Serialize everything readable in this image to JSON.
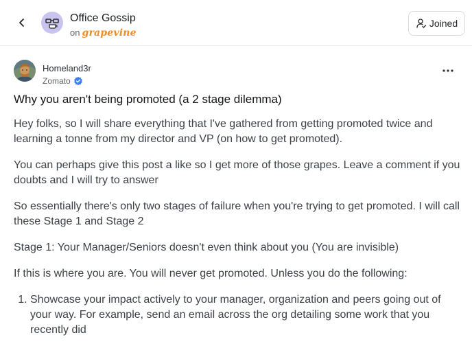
{
  "header": {
    "community_name": "Office Gossip",
    "on_label": "on",
    "brand_name": "grapevine",
    "joined_label": "Joined"
  },
  "post": {
    "author": {
      "name": "Homeland3r",
      "company": "Zomato",
      "verified": true
    },
    "title": "Why you aren't being promoted (a 2 stage dilemma)",
    "paragraphs": [
      "Hey folks, so I will share everything that I've gathered from getting promoted twice and learning a tonne from my director and VP (on how to get promoted).",
      "You can perhaps give this post a like so I get more of those grapes. Leave a comment if you doubts and I will try to answer",
      "So essentially there's only two stages of failure when you're trying to get promoted. I will call these Stage 1 and Stage 2",
      "Stage 1: Your Manager/Seniors doesn't even think about you (You are invisible)",
      "If this is where you are. You will never get promoted. Unless you do the following:"
    ],
    "list_items": [
      "Showcase your impact actively to your manager, organization and peers going out of your way. For example, send an email across the org detailing some work that you recently did"
    ]
  },
  "colors": {
    "brand": "#f08a24",
    "verified": "#3b82f6",
    "community_avatar_bg": "#c9c3f0"
  },
  "icons": {
    "back": "chevron-left-icon",
    "joined": "user-icon",
    "more": "more-horizontal-icon",
    "verified": "verified-badge-icon"
  }
}
